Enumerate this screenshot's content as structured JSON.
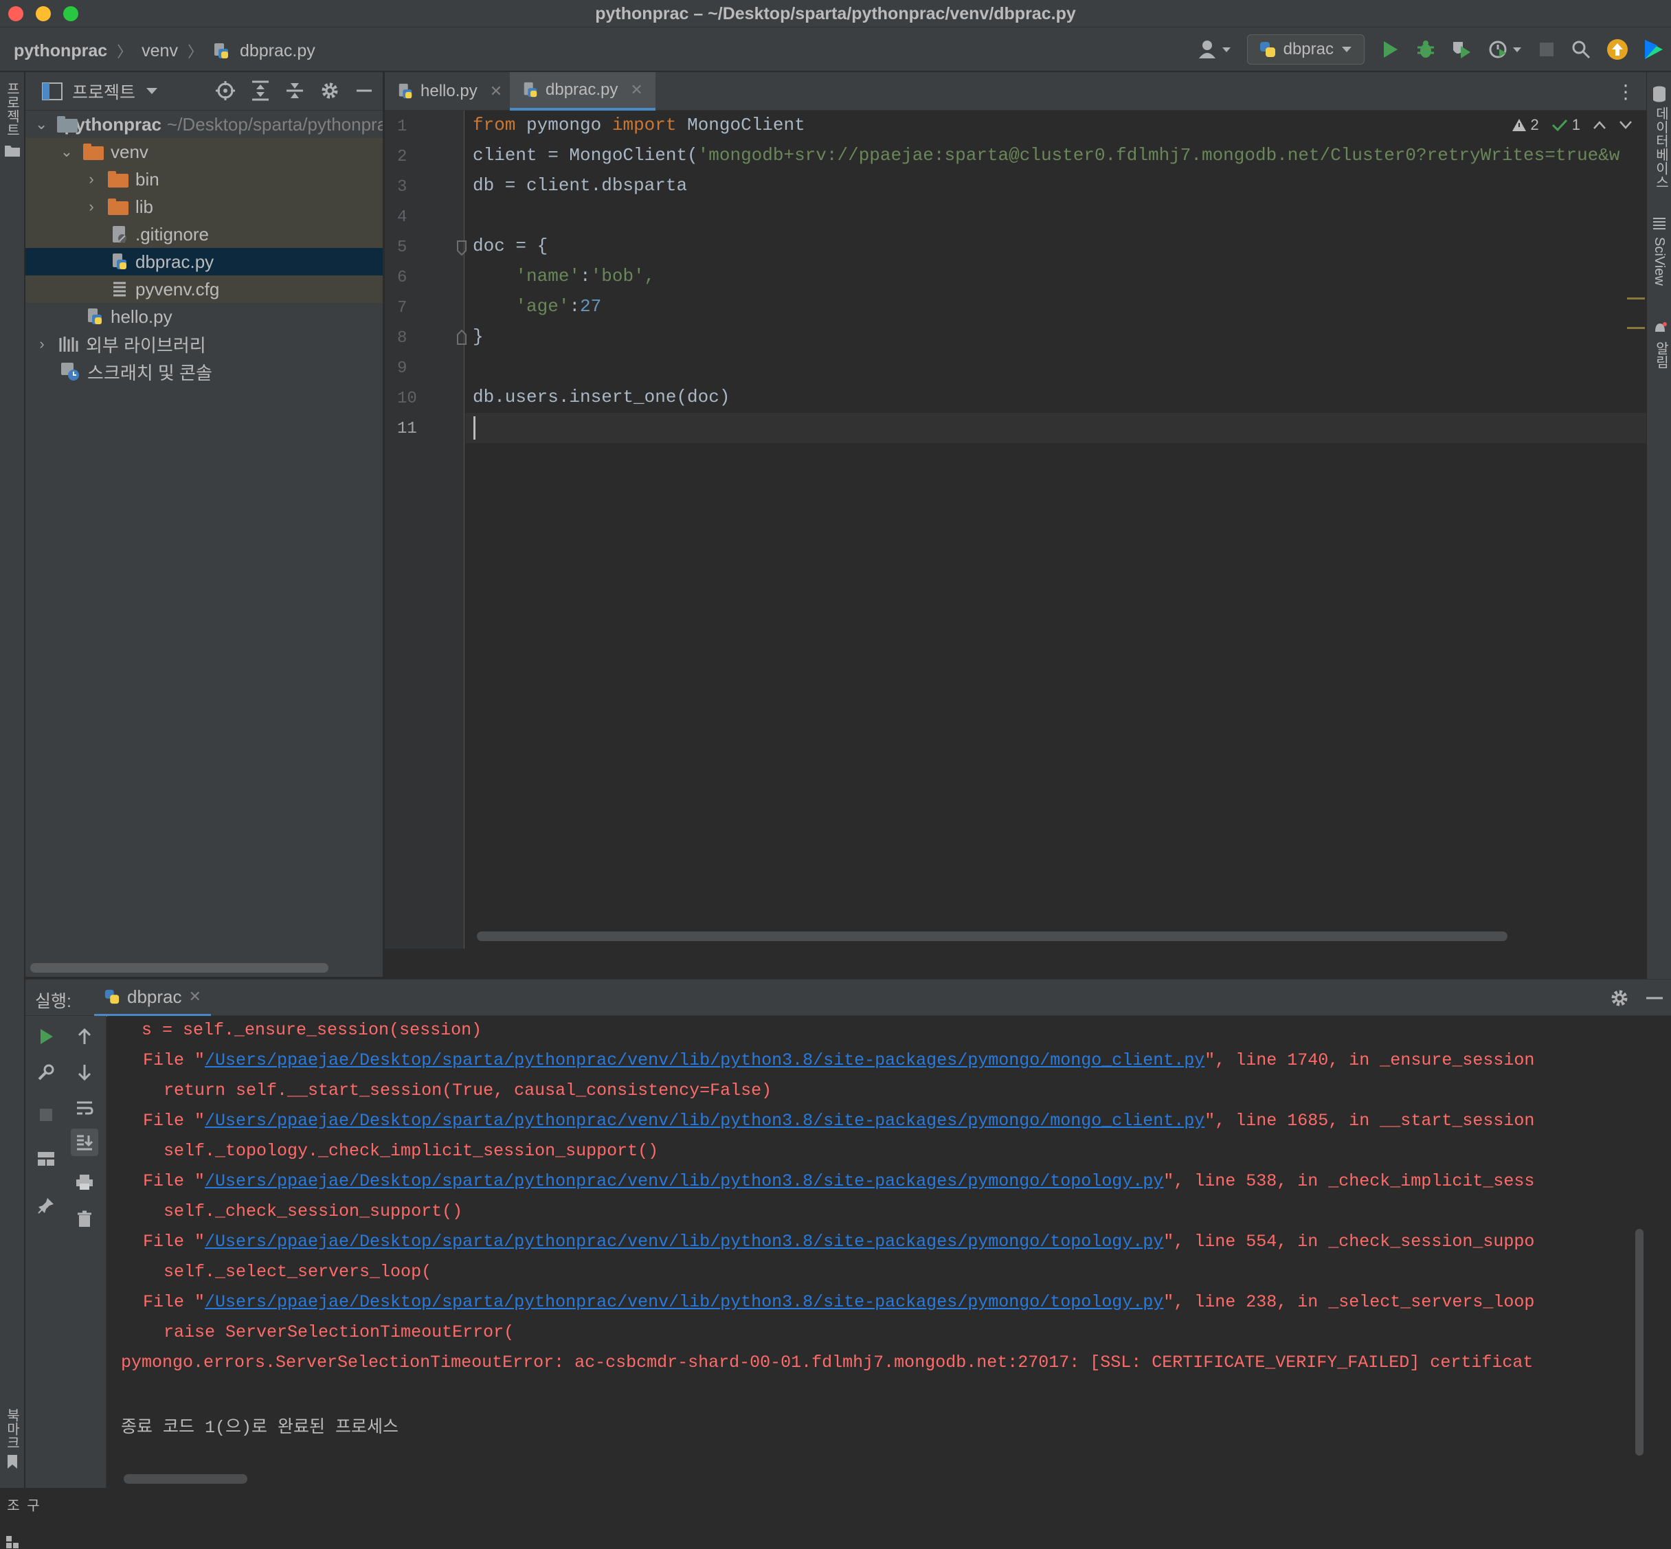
{
  "window": {
    "title": "pythonprac – ~/Desktop/sparta/pythonprac/venv/dbprac.py"
  },
  "breadcrumb": {
    "root": "pythonprac",
    "folder": "venv",
    "file": "dbprac.py"
  },
  "toolbar": {
    "run_config": "dbprac"
  },
  "sidebar": {
    "left_top_label": "프로젝트",
    "left_bottom_label1": "북마크",
    "left_bottom_label2": "구조",
    "right_label1": "데이터베이스",
    "right_label2": "SciView",
    "right_label3": "알림"
  },
  "project_panel": {
    "title": "프로젝트",
    "tree": [
      {
        "label": "pythonprac",
        "hint": "~/Desktop/sparta/pythonprac"
      },
      {
        "label": "venv"
      },
      {
        "label": "bin"
      },
      {
        "label": "lib"
      },
      {
        "label": ".gitignore"
      },
      {
        "label": "dbprac.py"
      },
      {
        "label": "pyvenv.cfg"
      },
      {
        "label": "hello.py"
      },
      {
        "label": "외부 라이브러리"
      },
      {
        "label": "스크래치 및 콘솔"
      }
    ]
  },
  "editor": {
    "tabs": [
      {
        "label": "hello.py"
      },
      {
        "label": "dbprac.py"
      }
    ],
    "warnings": "2",
    "checks": "1",
    "line_numbers": [
      "1",
      "2",
      "3",
      "4",
      "5",
      "6",
      "7",
      "8",
      "9",
      "10",
      "11"
    ],
    "code": {
      "l1_from": "from",
      "l1_mod": " pymongo ",
      "l1_import": "import",
      "l1_name": " MongoClient",
      "l2_a": "client = MongoClient(",
      "l2_str": "'mongodb+srv://ppaejae:sparta@cluster0.fdlmhj7.mongodb.net/Cluster0?retryWrites=true&w",
      "l3": "db = client.dbsparta",
      "l5": "doc = {",
      "l6_k": "    'name'",
      "l6_c": ":",
      "l6_v": "'bob',",
      "l7_k": "    'age'",
      "l7_c": ":",
      "l7_v": "27",
      "l8": "}",
      "l10": "db.users.insert_one(doc)"
    }
  },
  "run": {
    "label": "실행:",
    "tab": "dbprac",
    "lines": [
      {
        "pre": "  s = self._ensure_session(session)"
      },
      {
        "pre": "File \"",
        "link": "/Users/ppaejae/Desktop/sparta/pythonprac/venv/lib/python3.8/site-packages/pymongo/mongo_client.py",
        "post": "\", line 1740, in _ensure_session"
      },
      {
        "pre": "  return self.__start_session(True, causal_consistency=False)"
      },
      {
        "pre": "File \"",
        "link": "/Users/ppaejae/Desktop/sparta/pythonprac/venv/lib/python3.8/site-packages/pymongo/mongo_client.py",
        "post": "\", line 1685, in __start_session"
      },
      {
        "pre": "  self._topology._check_implicit_session_support()"
      },
      {
        "pre": "File \"",
        "link": "/Users/ppaejae/Desktop/sparta/pythonprac/venv/lib/python3.8/site-packages/pymongo/topology.py",
        "post": "\", line 538, in _check_implicit_sess"
      },
      {
        "pre": "  self._check_session_support()"
      },
      {
        "pre": "File \"",
        "link": "/Users/ppaejae/Desktop/sparta/pythonprac/venv/lib/python3.8/site-packages/pymongo/topology.py",
        "post": "\", line 554, in _check_session_suppo"
      },
      {
        "pre": "  self._select_servers_loop("
      },
      {
        "pre": "File \"",
        "link": "/Users/ppaejae/Desktop/sparta/pythonprac/venv/lib/python3.8/site-packages/pymongo/topology.py",
        "post": "\", line 238, in _select_servers_loop"
      },
      {
        "pre": "  raise ServerSelectionTimeoutError("
      },
      {
        "pre": "pymongo.errors.ServerSelectionTimeoutError: ac-csbcmdr-shard-00-01.fdlmhj7.mongodb.net:27017: [SSL: CERTIFICATE_VERIFY_FAILED] certificat"
      }
    ],
    "exit": "종료 코드 1(으)로 완료된 프로세스"
  }
}
